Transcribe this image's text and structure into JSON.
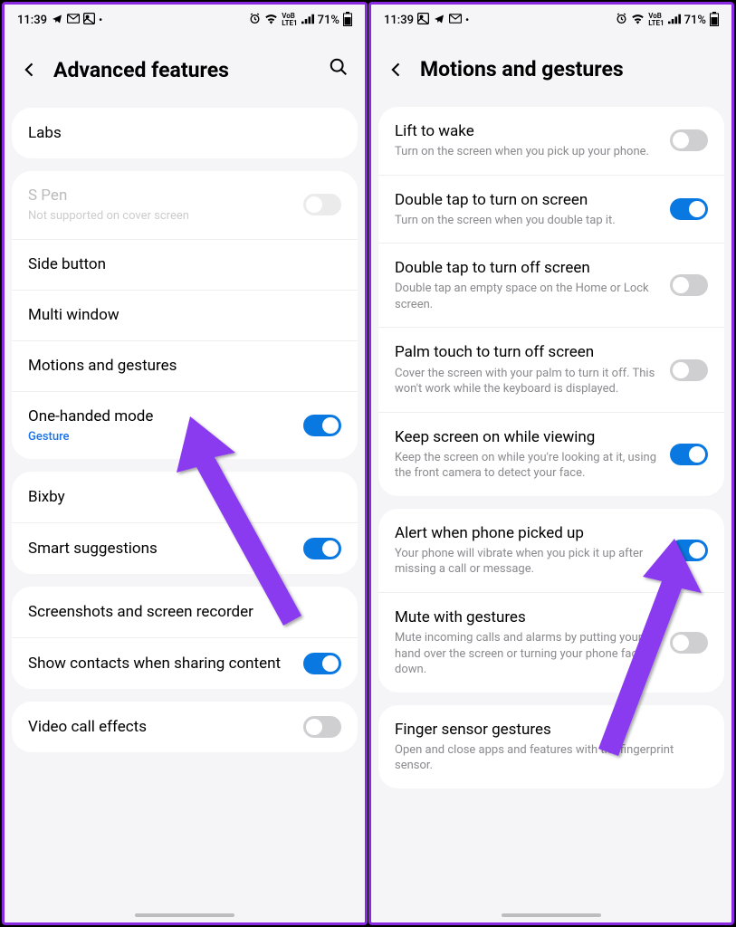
{
  "status": {
    "time": "11:39",
    "battery": "71%"
  },
  "left": {
    "title": "Advanced features",
    "items": {
      "labs": "Labs",
      "spen": "S Pen",
      "spen_sub": "Not supported on cover screen",
      "side_button": "Side button",
      "multi_window": "Multi window",
      "motions": "Motions and gestures",
      "one_handed": "One-handed mode",
      "one_handed_sub": "Gesture",
      "bixby": "Bixby",
      "smart_suggestions": "Smart suggestions",
      "screenshots": "Screenshots and screen recorder",
      "show_contacts": "Show contacts when sharing content",
      "video_call": "Video call effects"
    }
  },
  "right": {
    "title": "Motions and gestures",
    "items": {
      "lift": "Lift to wake",
      "lift_sub": "Turn on the screen when you pick up your phone.",
      "dtap_on": "Double tap to turn on screen",
      "dtap_on_sub": "Turn on the screen when you double tap it.",
      "dtap_off": "Double tap to turn off screen",
      "dtap_off_sub": "Double tap an empty space on the Home or Lock screen.",
      "palm": "Palm touch to turn off screen",
      "palm_sub": "Cover the screen with your palm to turn it off. This won't work while the keyboard is displayed.",
      "keep": "Keep screen on while viewing",
      "keep_sub": "Keep the screen on while you're looking at it, using the front camera to detect your face.",
      "alert": "Alert when phone picked up",
      "alert_sub": "Your phone will vibrate when you pick it up after missing a call or message.",
      "mute": "Mute with gestures",
      "mute_sub": "Mute incoming calls and alarms by putting your hand over the screen or turning your phone face down.",
      "finger": "Finger sensor gestures",
      "finger_sub": "Open and close apps and features with the fingerprint sensor."
    }
  }
}
